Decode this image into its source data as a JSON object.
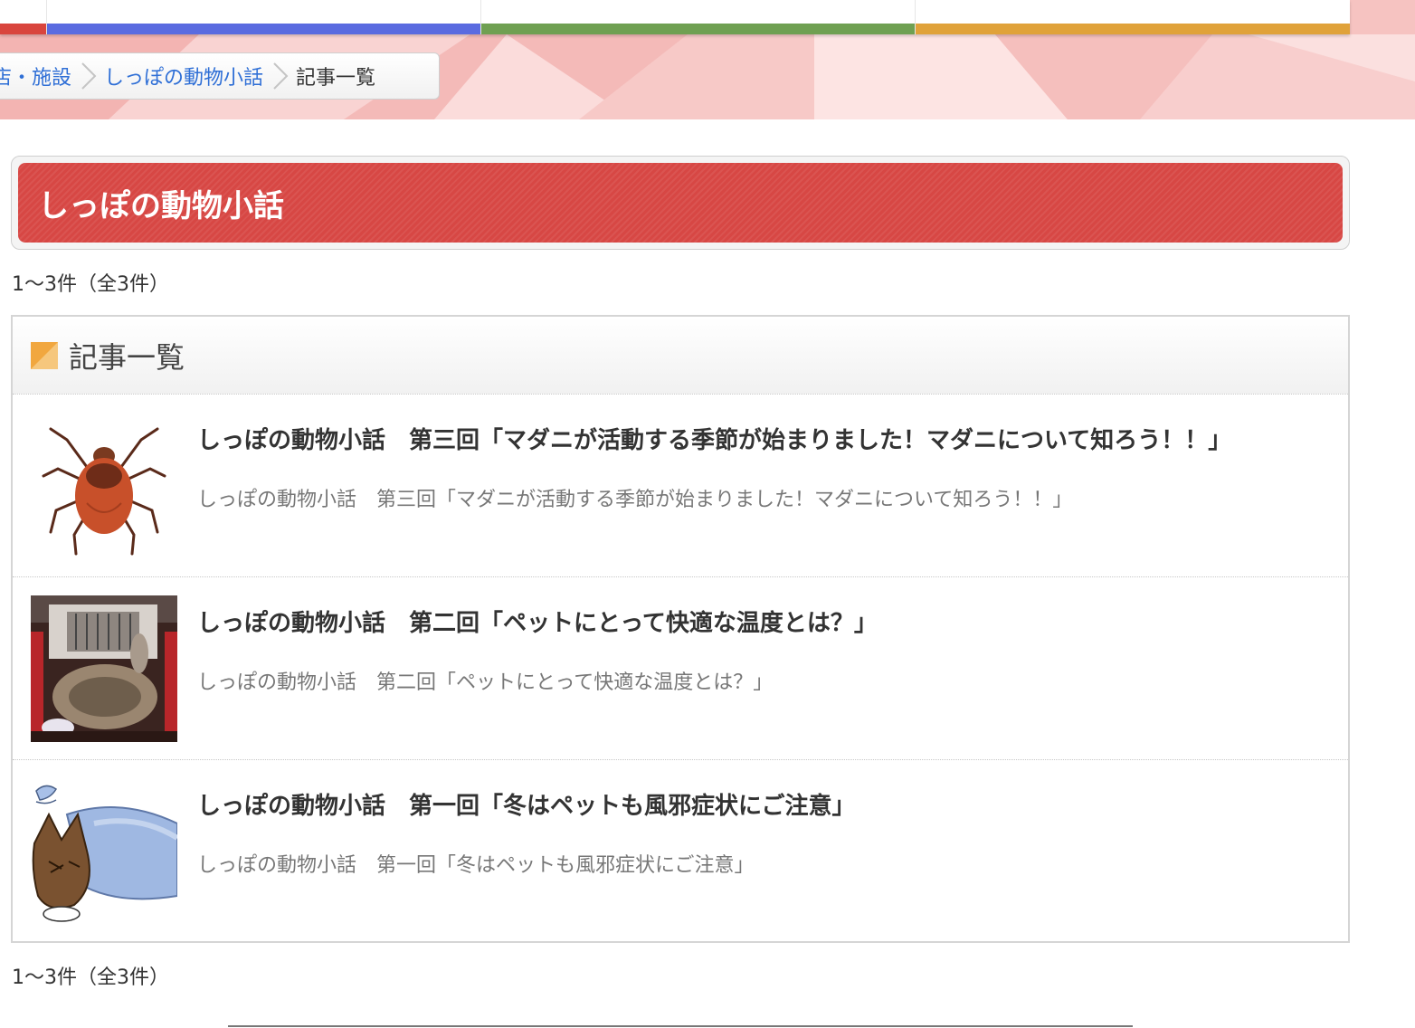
{
  "nav": {
    "tabs": [
      {
        "id": "red",
        "color": "#d9453d"
      },
      {
        "id": "blue",
        "color": "#5a6be0"
      },
      {
        "id": "green",
        "color": "#6fa052"
      },
      {
        "id": "orange",
        "color": "#e0a23a"
      }
    ]
  },
  "breadcrumb": {
    "items": [
      {
        "label": "店・施設",
        "link": true
      },
      {
        "label": "しっぽの動物小話",
        "link": true
      },
      {
        "label": "記事一覧",
        "link": false
      }
    ]
  },
  "page": {
    "title": "しっぽの動物小話",
    "count_top": "1〜3件（全3件）",
    "count_bottom": "1〜3件（全3件）"
  },
  "list": {
    "header": "記事一覧",
    "header_icon": "orange-square-icon",
    "articles": [
      {
        "title": "しっぽの動物小話　第三回「マダニが活動する季節が始まりました！マダニについて知ろう！！」",
        "summary": "しっぽの動物小話　第三回「マダニが活動する季節が始まりました！マダニについて知ろう！！」",
        "thumbnail": "tick-illustration"
      },
      {
        "title": "しっぽの動物小話　第二回「ペットにとって快適な温度とは？」",
        "summary": "しっぽの動物小話　第二回「ペットにとって快適な温度とは？」",
        "thumbnail": "pet-carrier-photo"
      },
      {
        "title": "しっぽの動物小話　第一回「冬はペットも風邪症状にご注意」",
        "summary": "しっぽの動物小話　第一回「冬はペットも風邪症状にご注意」",
        "thumbnail": "sick-cat-illustration"
      }
    ]
  },
  "colors": {
    "title_bar": "#d74744",
    "link": "#2f6fd6",
    "banner": "#f6c3c1"
  }
}
